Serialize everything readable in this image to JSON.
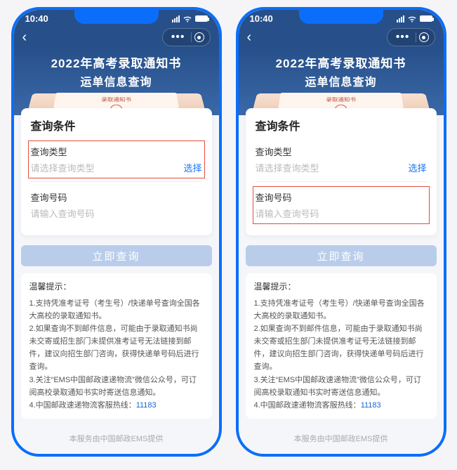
{
  "status": {
    "time": "10:40"
  },
  "banner": {
    "title": "2022年高考录取通知书",
    "subtitle": "运单信息查询",
    "letter_label": "录取通知书"
  },
  "card": {
    "title": "查询条件",
    "type_label": "查询类型",
    "type_placeholder": "请选择查询类型",
    "select_text": "选择",
    "number_label": "查询号码",
    "number_placeholder": "请输入查询号码"
  },
  "submit": "立即查询",
  "tips": {
    "heading": "温馨提示：",
    "line1": "1.支持凭准考证号（考生号）/快递单号查询全国各大高校的录取通知书。",
    "line2": "2.如果查询不到邮件信息，可能由于录取通知书尚未交寄或招生部门未提供准考证号无法链接到邮件，建议向招生部门咨询，获得快递单号码后进行查询。",
    "line3_pre": "3.关注“EMS中国邮政速递物流”微信公众号，可订阅高校录取通知书实时寄送信息通知。",
    "line4_pre": "4.中国邮政速递物流客服热线：",
    "hotline": "11183"
  },
  "footer": "本服务由中国邮政EMS提供"
}
